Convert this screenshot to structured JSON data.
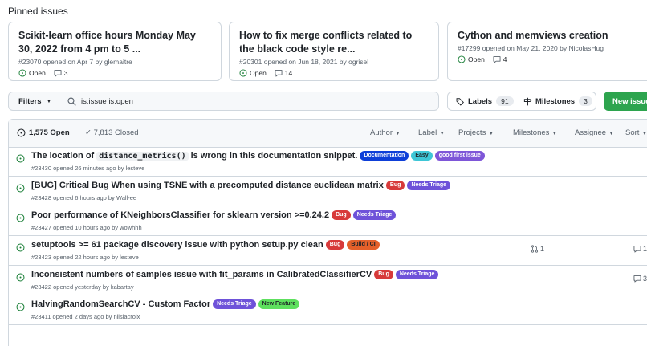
{
  "pinned": {
    "title": "Pinned issues",
    "cards": [
      {
        "title": "Scikit-learn office hours Monday May 30, 2022 from 4 pm to 5 ...",
        "meta": "#23070 opened on Apr 7 by glemaitre",
        "status": "Open",
        "comments": "3"
      },
      {
        "title": "How to fix merge conflicts related to the black code style re...",
        "meta": "#20301 opened on Jun 18, 2021 by ogrisel",
        "status": "Open",
        "comments": "14"
      },
      {
        "title": "Cython and memviews creation",
        "meta": "#17299 opened on May 21, 2020 by NicolasHug",
        "status": "Open",
        "comments": "4"
      }
    ]
  },
  "toolbar": {
    "filters_label": "Filters",
    "search_value": "is:issue is:open",
    "labels_label": "Labels",
    "labels_count": "91",
    "milestones_label": "Milestones",
    "milestones_count": "3",
    "new_issue_label": "New issue"
  },
  "list_header": {
    "open_count": "1,575 Open",
    "closed_count": "7,813 Closed",
    "filters": [
      "Author",
      "Label",
      "Projects",
      "Milestones",
      "Assignee",
      "Sort"
    ]
  },
  "issues": [
    {
      "title_pre": "The location of",
      "title_code": "distance_metrics()",
      "title_post": "is wrong in this documentation snippet.",
      "meta": "#23430 opened 26 minutes ago by lesteve",
      "labels": [
        {
          "name": "Documentation",
          "bg": "#0e3fd8",
          "fg": "#ffffff"
        },
        {
          "name": "Easy",
          "bg": "#3ec6d6",
          "fg": "#1f2328"
        },
        {
          "name": "good first issue",
          "bg": "#7e56d8",
          "fg": "#ffffff"
        }
      ],
      "prs": "",
      "comments": ""
    },
    {
      "title_pre": "[BUG] Critical Bug When using TSNE with a precomputed distance euclidean matrix",
      "title_code": "",
      "title_post": "",
      "meta": "#23428 opened 6 hours ago by Wall-ee",
      "labels": [
        {
          "name": "Bug",
          "bg": "#d73a3a",
          "fg": "#ffffff"
        },
        {
          "name": "Needs Triage",
          "bg": "#6e52d9",
          "fg": "#ffffff"
        }
      ],
      "prs": "",
      "comments": ""
    },
    {
      "title_pre": "Poor performance of KNeighborsClassifier for sklearn version >=0.24.2",
      "title_code": "",
      "title_post": "",
      "meta": "#23427 opened 10 hours ago by wowhhh",
      "labels": [
        {
          "name": "Bug",
          "bg": "#d73a3a",
          "fg": "#ffffff"
        },
        {
          "name": "Needs Triage",
          "bg": "#6e52d9",
          "fg": "#ffffff"
        }
      ],
      "prs": "",
      "comments": ""
    },
    {
      "title_pre": "setuptools >= 61 package discovery issue with python setup.py clean",
      "title_code": "",
      "title_post": "",
      "meta": "#23423 opened 22 hours ago by lesteve",
      "labels": [
        {
          "name": "Bug",
          "bg": "#d73a3a",
          "fg": "#ffffff"
        },
        {
          "name": "Build / CI",
          "bg": "#e4602a",
          "fg": "#1f2328"
        }
      ],
      "prs": "1",
      "comments": "1"
    },
    {
      "title_pre": "Inconsistent numbers of samples issue with fit_params in CalibratedClassifierCV",
      "title_code": "",
      "title_post": "",
      "meta": "#23422 opened yesterday by kabartay",
      "labels": [
        {
          "name": "Bug",
          "bg": "#d73a3a",
          "fg": "#ffffff"
        },
        {
          "name": "Needs Triage",
          "bg": "#6e52d9",
          "fg": "#ffffff"
        }
      ],
      "prs": "",
      "comments": "3"
    },
    {
      "title_pre": "HalvingRandomSearchCV - Custom Factor",
      "title_code": "",
      "title_post": "",
      "meta": "#23411 opened 2 days ago by nilslacroix",
      "labels": [
        {
          "name": "Needs Triage",
          "bg": "#6e52d9",
          "fg": "#ffffff"
        },
        {
          "name": "New Feature",
          "bg": "#5ee05e",
          "fg": "#1f2328"
        }
      ],
      "prs": "",
      "comments": ""
    }
  ],
  "colors": {
    "open_green": "#1a7f37",
    "new_issue_bg": "#2da44e",
    "border": "#d0d7de"
  }
}
